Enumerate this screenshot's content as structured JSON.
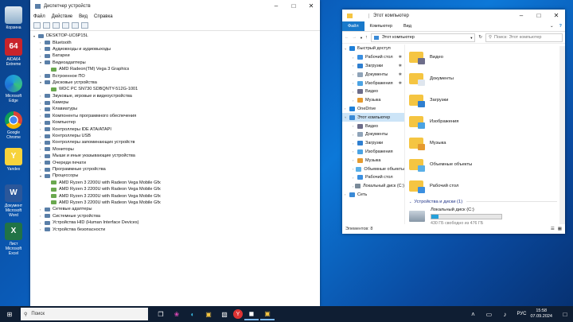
{
  "desktop_icons": [
    {
      "label": "Корзина",
      "icon": "recycle-bin-icon",
      "color": "#7ea6c9"
    },
    {
      "label": "AIDA64 Extreme",
      "icon": "aida64-icon",
      "color": "#c8242b",
      "text": "64"
    },
    {
      "label": "Microsoft Edge",
      "icon": "edge-icon",
      "color": "#1fa0d8"
    },
    {
      "label": "Google Chrome",
      "icon": "chrome-icon",
      "color": "#e8eaed"
    },
    {
      "label": "Yandex",
      "icon": "yandex-icon",
      "color": "#f7d33b",
      "text": "Y"
    },
    {
      "label": "Документ Microsoft Word",
      "icon": "word-icon",
      "color": "#2b579a",
      "text": "W"
    },
    {
      "label": "Лист Microsoft Excel",
      "icon": "excel-icon",
      "color": "#217346",
      "text": "X"
    }
  ],
  "device_manager": {
    "title": "Диспетчер устройств",
    "menu": [
      "Файл",
      "Действие",
      "Вид",
      "Справка"
    ],
    "tree": [
      {
        "label": "DESKTOP-UC6P15L",
        "level": 0,
        "expanded": true
      },
      {
        "label": "Bluetooth",
        "level": 1
      },
      {
        "label": "Аудиовходы и аудиовыходы",
        "level": 1
      },
      {
        "label": "Батареи",
        "level": 1
      },
      {
        "label": "Видеоадаптеры",
        "level": 1,
        "expanded": true
      },
      {
        "label": "AMD Radeon(TM) Vega 3 Graphics",
        "level": 2
      },
      {
        "label": "Встроенное ПО",
        "level": 1
      },
      {
        "label": "Дисковые устройства",
        "level": 1,
        "expanded": true
      },
      {
        "label": "WDC PC SN730 SDBQNTY-512G-1001",
        "level": 2
      },
      {
        "label": "Звуковые, игровые и видеоустройства",
        "level": 1
      },
      {
        "label": "Камеры",
        "level": 1
      },
      {
        "label": "Клавиатуры",
        "level": 1
      },
      {
        "label": "Компоненты программного обеспечения",
        "level": 1
      },
      {
        "label": "Компьютер",
        "level": 1
      },
      {
        "label": "Контроллеры IDE ATA/ATAPI",
        "level": 1
      },
      {
        "label": "Контроллеры USB",
        "level": 1
      },
      {
        "label": "Контроллеры запоминающих устройств",
        "level": 1
      },
      {
        "label": "Мониторы",
        "level": 1
      },
      {
        "label": "Мыши и иные указывающие устройства",
        "level": 1
      },
      {
        "label": "Очереди печати",
        "level": 1
      },
      {
        "label": "Программные устройства",
        "level": 1
      },
      {
        "label": "Процессоры",
        "level": 1,
        "expanded": true
      },
      {
        "label": "AMD Ryzen 3 2200U with Radeon Vega Mobile Gfx",
        "level": 2
      },
      {
        "label": "AMD Ryzen 3 2200U with Radeon Vega Mobile Gfx",
        "level": 2
      },
      {
        "label": "AMD Ryzen 3 2200U with Radeon Vega Mobile Gfx",
        "level": 2
      },
      {
        "label": "AMD Ryzen 3 2200U with Radeon Vega Mobile Gfx",
        "level": 2
      },
      {
        "label": "Сетевые адаптеры",
        "level": 1
      },
      {
        "label": "Системные устройства",
        "level": 1
      },
      {
        "label": "Устройства HID (Human Interface Devices)",
        "level": 1
      },
      {
        "label": "Устройства безопасности",
        "level": 1
      }
    ]
  },
  "explorer": {
    "title": "Этот компьютер",
    "ribbon_tabs": [
      "Файл",
      "Компьютер",
      "Вид"
    ],
    "address": "Этот компьютер",
    "search_placeholder": "Поиск: Этот компьютер",
    "nav": [
      {
        "label": "Быстрый доступ",
        "level": 0,
        "color": "#1e7fd8"
      },
      {
        "label": "Рабочий стол",
        "level": 1,
        "color": "#3b8fe0",
        "pin": true
      },
      {
        "label": "Загрузки",
        "level": 1,
        "color": "#2f7fd0",
        "pin": true
      },
      {
        "label": "Документы",
        "level": 1,
        "color": "#8fa3b8",
        "pin": true
      },
      {
        "label": "Изображения",
        "level": 1,
        "color": "#4ba3e3",
        "pin": true
      },
      {
        "label": "Видео",
        "level": 1,
        "color": "#6d6d8a"
      },
      {
        "label": "Музыка",
        "level": 1,
        "color": "#e59a2e"
      },
      {
        "label": "OneDrive",
        "level": 0,
        "color": "#1e7fd8"
      },
      {
        "label": "Этот компьютер",
        "level": 0,
        "color": "#3a8ad6",
        "selected": true
      },
      {
        "label": "Видео",
        "level": 1,
        "color": "#6d6d8a"
      },
      {
        "label": "Документы",
        "level": 1,
        "color": "#8fa3b8"
      },
      {
        "label": "Загрузки",
        "level": 1,
        "color": "#2f7fd0"
      },
      {
        "label": "Изображения",
        "level": 1,
        "color": "#4ba3e3"
      },
      {
        "label": "Музыка",
        "level": 1,
        "color": "#e59a2e"
      },
      {
        "label": "Объемные объекты",
        "level": 1,
        "color": "#5ab0e8"
      },
      {
        "label": "Рабочий стол",
        "level": 1,
        "color": "#3b8fe0"
      },
      {
        "label": "Локальный диск (C:)",
        "level": 1,
        "color": "#7a8a99"
      },
      {
        "label": "Сеть",
        "level": 0,
        "color": "#3a8ad6"
      }
    ],
    "folders": [
      {
        "label": "Видео",
        "icon": "video-folder-icon"
      },
      {
        "label": "Документы",
        "icon": "documents-folder-icon"
      },
      {
        "label": "Загрузки",
        "icon": "downloads-folder-icon"
      },
      {
        "label": "Изображения",
        "icon": "pictures-folder-icon"
      },
      {
        "label": "Музыка",
        "icon": "music-folder-icon"
      },
      {
        "label": "Объемные объекты",
        "icon": "3d-objects-folder-icon"
      },
      {
        "label": "Рабочий стол",
        "icon": "desktop-folder-icon"
      }
    ],
    "devices_header": "Устройства и диски (1)",
    "drive": {
      "label": "Локальный диск (C:)",
      "free_text": "430 ГБ свободно из 476 ГБ",
      "used_fraction": 0.097
    },
    "status": "Элементов: 8"
  },
  "taskbar": {
    "search_placeholder": "Поиск",
    "lang": "РУС",
    "time": "15:58",
    "date": "07.09.2024"
  },
  "colors": {
    "accent": "#1979ca",
    "drive_bar": "#26a0da"
  }
}
